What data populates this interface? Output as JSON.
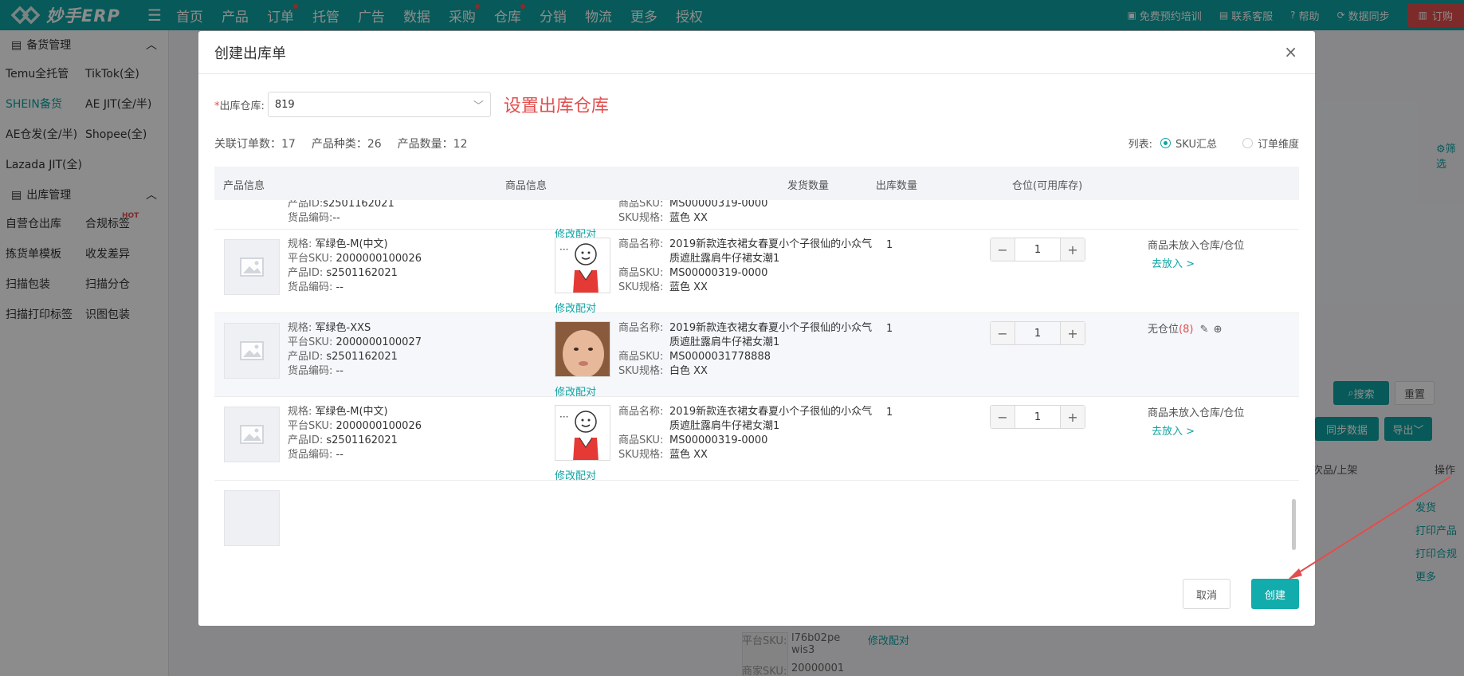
{
  "topbar": {
    "logo_text": "妙手ERP",
    "nav": [
      "首页",
      "产品",
      "订单",
      "托管",
      "广告",
      "数据",
      "采购",
      "仓库",
      "分销",
      "物流",
      "更多",
      "授权"
    ],
    "right": [
      "免费预约培训",
      "联系客服",
      "帮助",
      "数据同步"
    ],
    "order_label": "订购"
  },
  "sidebar": {
    "section1": "备货管理",
    "items1": [
      "Temu全托管",
      "TikTok(全)",
      "SHEIN备货",
      "AE JIT(全/半)",
      "AE仓发(全/半)",
      "Shopee(全)",
      "Lazada JIT(全)"
    ],
    "section2": "出库管理",
    "items2": [
      "自营仓出库",
      "合规标签",
      "拣货单模板",
      "收发差异",
      "扫描包装",
      "扫描分仓",
      "扫描打印标签",
      "识图包装"
    ],
    "hot_badge": "HOT"
  },
  "background": {
    "search": "搜索",
    "reset": "重置",
    "sync": "同步数据",
    "export": "导出",
    "filter": "筛选",
    "col_defect": "次品/上架",
    "col_action": "操作",
    "actions": [
      "发货",
      "打印产品",
      "打印合规",
      "更多"
    ],
    "bg_sku_label": "平台SKU:",
    "bg_sku": "l76b02pe wis3",
    "bg_merchant_label": "商家SKU:",
    "bg_merchant": "20000001",
    "bg_match": "修改配对"
  },
  "modal": {
    "title": "创建出库单",
    "warehouse_label": "出库仓库:",
    "warehouse_value": "819",
    "warehouse_hint": "设置出库仓库",
    "stats": {
      "orders": "关联订单数：17",
      "kinds": "产品种类：26",
      "quantity": "产品数量：12"
    },
    "view_label": "列表:",
    "view_options": [
      "SKU汇总",
      "订单维度"
    ],
    "columns": [
      "产品信息",
      "商品信息",
      "发货数量",
      "出库数量",
      "仓位(可用库存)"
    ],
    "labels": {
      "spec": "规格:",
      "platform_sku": "平台SKU:",
      "product_id": "产品ID:",
      "goods_code": "货品编码:",
      "goods_name": "商品名称:",
      "goods_sku": "商品SKU:",
      "sku_spec": "SKU规格:",
      "modify_match": "修改配对",
      "go_place": "去放入 >"
    },
    "partial_row": {
      "product_id": "s2501162021",
      "goods_code": "--",
      "goods_sku": "MS00000319-0000",
      "sku_spec": "蓝色 XX"
    },
    "rows": [
      {
        "spec": "军绿色-M(中文)",
        "platform_sku": "2000000100026",
        "product_id": "s2501162021",
        "goods_code": "--",
        "goods_name": "2019新款连衣裙女春夏小个子很仙的小众气质遮肚露肩牛仔裙女潮1",
        "goods_sku": "MS00000319-0000",
        "sku_spec": "蓝色 XX",
        "ship_qty": "1",
        "out_qty": "1",
        "location": "商品未放入仓库/仓位"
      },
      {
        "spec": "军绿色-XXS",
        "platform_sku": "2000000100027",
        "product_id": "s2501162021",
        "goods_code": "--",
        "goods_name": "2019新款连衣裙女春夏小个子很仙的小众气质遮肚露肩牛仔裙女潮1",
        "goods_sku": "MS0000031778888",
        "sku_spec": "白色 XX",
        "ship_qty": "1",
        "out_qty": "1",
        "location": "无仓位",
        "location_count": "(8)"
      },
      {
        "spec": "军绿色-M(中文)",
        "platform_sku": "2000000100026",
        "product_id": "s2501162021",
        "goods_code": "--",
        "goods_name": "2019新款连衣裙女春夏小个子很仙的小众气质遮肚露肩牛仔裙女潮1",
        "goods_sku": "MS00000319-0000",
        "sku_spec": "蓝色 XX",
        "ship_qty": "1",
        "out_qty": "1",
        "location": "商品未放入仓库/仓位"
      }
    ],
    "cancel_label": "取消",
    "create_label": "创建"
  },
  "colors": {
    "accent": "#0fa3a3",
    "danger": "#e34d4d"
  }
}
